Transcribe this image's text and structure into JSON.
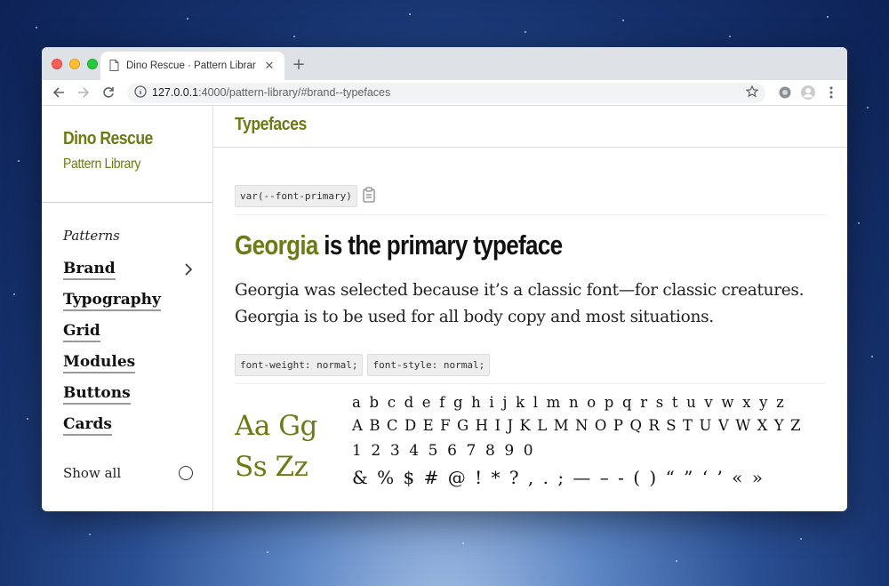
{
  "browser": {
    "tab_title": "Dino Rescue · Pattern Library",
    "url_host": "127.0.0.1",
    "url_path": ":4000/pattern-library/#brand--typefaces"
  },
  "sidebar": {
    "brand_name": "Dino Rescue",
    "brand_subtitle": "Pattern Library",
    "patterns_label": "Patterns",
    "items": [
      {
        "label": "Brand"
      },
      {
        "label": "Typography"
      },
      {
        "label": "Grid"
      },
      {
        "label": "Modules"
      },
      {
        "label": "Buttons"
      },
      {
        "label": "Cards"
      }
    ],
    "show_all_label": "Show all"
  },
  "main": {
    "section_title": "Typefaces",
    "css_var": "var(--font-primary)",
    "heading_accent": "Georgia",
    "heading_rest": " is the primary typeface",
    "description": "Georgia was selected because it’s a classic font—for classic creatures. Georgia is to be used for all body copy and most situations.",
    "font_weight_chip": "font-weight: normal;",
    "font_style_chip": "font-style: normal;",
    "specimen_big_1": "Aa Gg",
    "specimen_big_2": "Ss Zz",
    "lowercase": "a b c d e f g h i j k l m n o p q r s t u v w x y z",
    "uppercase": "A B C D E F G H I J K L M N O P Q R S T U V W X Y Z",
    "numerals": "1 2 3 4 5 6 7 8 9 0",
    "symbols": "& % $ # @ ! * ? , . ; — – - ( ) “ ” ‘ ’ « »"
  },
  "colors": {
    "accent": "#6e7a14",
    "chrome_bg": "#dee1e6"
  }
}
